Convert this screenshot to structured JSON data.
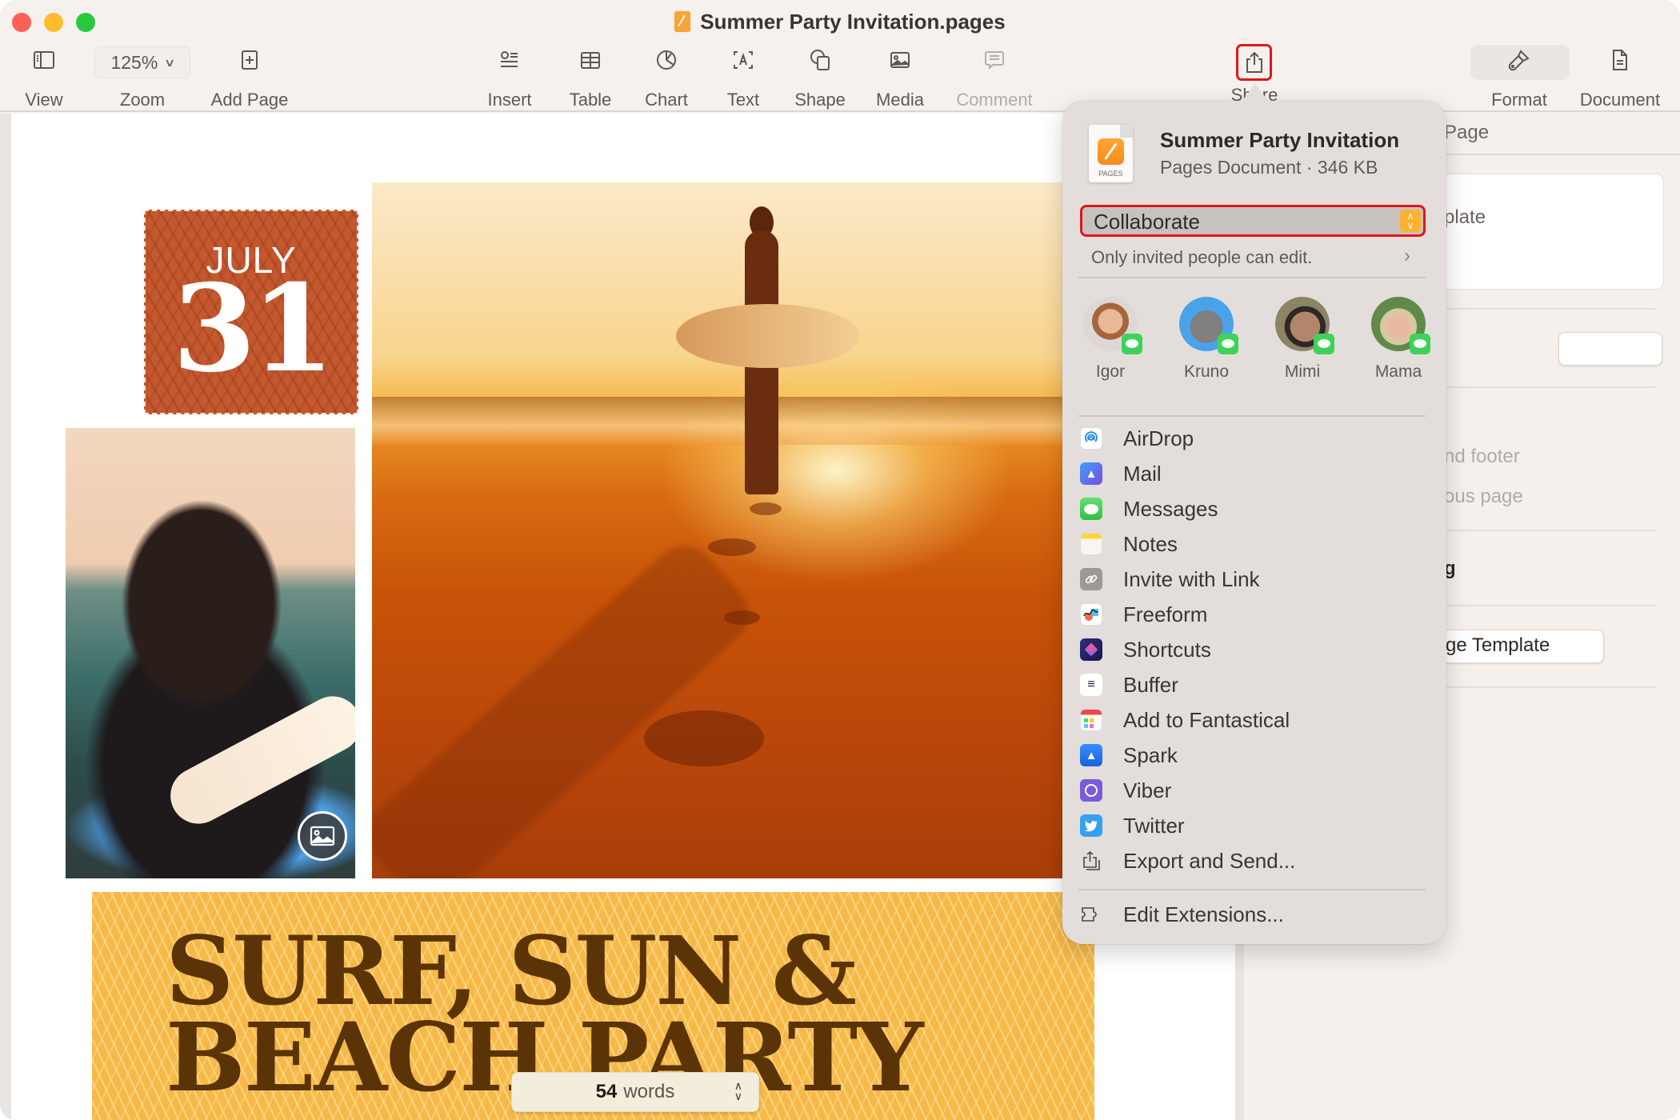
{
  "window": {
    "title": "Summer Party Invitation.pages"
  },
  "toolbar": {
    "view": "View",
    "zoom_value": "125%",
    "zoom": "Zoom",
    "add_page": "Add Page",
    "insert": "Insert",
    "table": "Table",
    "chart": "Chart",
    "text": "Text",
    "shape": "Shape",
    "media": "Media",
    "comment": "Comment",
    "share": "Share",
    "format": "Format",
    "document": "Document"
  },
  "document": {
    "date_month": "JULY",
    "date_day": "31",
    "headline_line1": "SURF, SUN &",
    "headline_line2": "BEACH PARTY",
    "word_count_number": "54",
    "word_count_label": "words"
  },
  "sidebar": {
    "tab_partial": "Page",
    "template_partial": "plate",
    "header_footer_partial": "nd footer",
    "previous_page_partial": "ous page",
    "bold_partial": "g",
    "template_button_partial": "ge Template"
  },
  "share_popover": {
    "doc_name": "Summer Party Invitation",
    "doc_meta": "Pages Document · 346 KB",
    "doc_icon_caption": "PAGES",
    "mode_selected": "Collaborate",
    "permission_note": "Only invited people can edit.",
    "people": [
      {
        "name": "Igor"
      },
      {
        "name": "Kruno"
      },
      {
        "name": "Mimi"
      },
      {
        "name": "Mama"
      }
    ],
    "items": [
      {
        "label": "AirDrop",
        "icon": "airdrop-icon"
      },
      {
        "label": "Mail",
        "icon": "mail-icon"
      },
      {
        "label": "Messages",
        "icon": "messages-icon"
      },
      {
        "label": "Notes",
        "icon": "notes-icon"
      },
      {
        "label": "Invite with Link",
        "icon": "link-icon"
      },
      {
        "label": "Freeform",
        "icon": "freeform-icon"
      },
      {
        "label": "Shortcuts",
        "icon": "shortcuts-icon"
      },
      {
        "label": "Buffer",
        "icon": "buffer-icon"
      },
      {
        "label": "Add to Fantastical",
        "icon": "fantastical-icon"
      },
      {
        "label": "Spark",
        "icon": "spark-icon"
      },
      {
        "label": "Viber",
        "icon": "viber-icon"
      },
      {
        "label": "Twitter",
        "icon": "twitter-icon"
      },
      {
        "label": "Export and Send...",
        "icon": "export-icon"
      }
    ],
    "edit_extensions": "Edit Extensions..."
  },
  "colors": {
    "highlight_red": "#e0161b",
    "collab_stepper": "#fbb22f",
    "date_block": "#c4582f",
    "banner": "#f6b947",
    "headline_text": "#5a3306"
  }
}
